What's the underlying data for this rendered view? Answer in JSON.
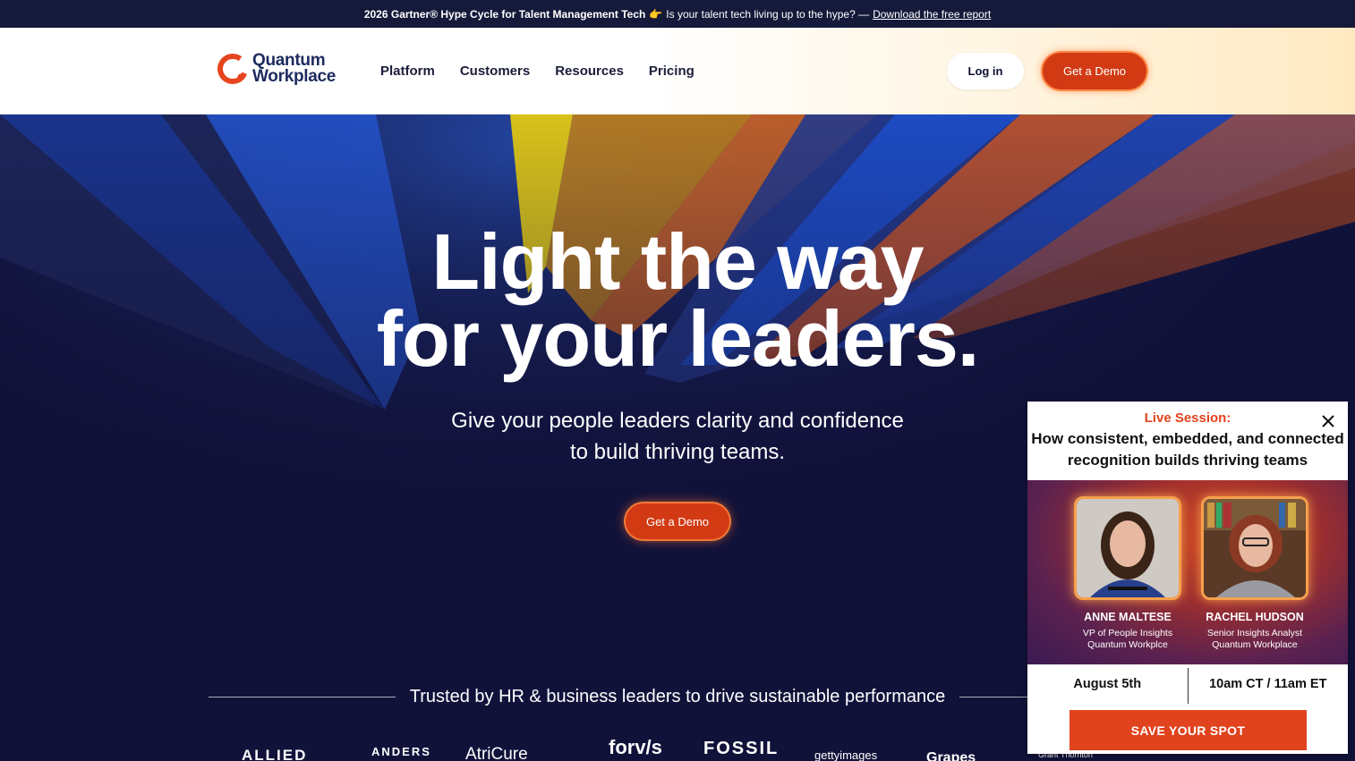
{
  "announcement": {
    "bold_text": "2026 Gartner® Hype Cycle for Talent Management Tech",
    "emoji": "👉",
    "text": "Is your talent tech living up to the hype? —",
    "link_label": "Download the free report"
  },
  "header": {
    "logo_line1": "Quantum",
    "logo_line2": "Workplace",
    "nav": [
      {
        "label": "Platform"
      },
      {
        "label": "Customers"
      },
      {
        "label": "Resources"
      },
      {
        "label": "Pricing"
      }
    ],
    "login_label": "Log in",
    "demo_label": "Get a Demo"
  },
  "hero": {
    "title_line1": "Light the way",
    "title_line2": "for your leaders.",
    "subtitle_line1": "Give your people leaders clarity and confidence",
    "subtitle_line2": "to build thriving teams.",
    "cta_label": "Get a Demo",
    "trusted_text": "Trusted by HR & business leaders to drive sustainable performance",
    "logos": [
      "ALLIED",
      "ANDERS",
      "AtriCure",
      "forv/s",
      "FOSSIL",
      "gettyimages",
      "Grapes",
      "Grant Thornton"
    ]
  },
  "popup": {
    "eyebrow": "Live Session:",
    "title_line1": "How consistent, embedded, and connected",
    "title_line2": "recognition builds thriving teams",
    "speakers": [
      {
        "name": "ANNE MALTESE",
        "role_line1": "VP of People Insights",
        "role_line2": "Quantum Workplce"
      },
      {
        "name": "RACHEL HUDSON",
        "role_line1": "Senior Insights Analyst",
        "role_line2": "Quantum Workplace"
      }
    ],
    "date": "August 5th",
    "time": "10am CT / 11am ET",
    "cta_label": "SAVE YOUR SPOT"
  },
  "colors": {
    "accent": "#d23a14",
    "navy": "#161a3a",
    "popup_orange": "#e0431d"
  }
}
